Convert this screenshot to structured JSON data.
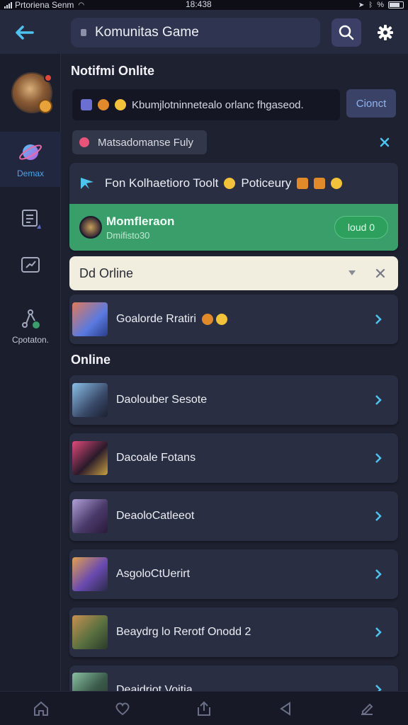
{
  "status_bar": {
    "carrier": "Prtoriena Senm",
    "time": "18:438",
    "battery": "%"
  },
  "header": {
    "title": "Komunitas Game"
  },
  "sidebar": {
    "items": [
      {
        "label": "Demax",
        "icon": "planet-icon",
        "active": true
      },
      {
        "label": "",
        "icon": "document-icon"
      },
      {
        "label": "",
        "icon": "chart-box-icon"
      },
      {
        "label": "Cpotaton.",
        "icon": "network-icon"
      }
    ]
  },
  "notifications": {
    "title": "Notifmi Onlite",
    "message": "Kbumjlotninnetealo orlanc fhgaseod.",
    "chat_button": "Cionct",
    "chip_label": "Matsadomanse Fuly"
  },
  "feature": {
    "text": "Fon Kolhaetioro Toolt",
    "text2": "Poticeury",
    "user_name": "Momfleraon",
    "user_sub": "Dmifisto30",
    "button": "loud 0"
  },
  "dropdown": {
    "label": "Dd Orline"
  },
  "top_item": {
    "label": "Goalorde Rratiri"
  },
  "online": {
    "title": "Online",
    "items": [
      {
        "label": "Daolouber Sesote"
      },
      {
        "label": "Dacoale Fotans"
      },
      {
        "label": "DeaoloCatleeot"
      },
      {
        "label": "AsgoloCtUerirt"
      },
      {
        "label": "Beaydrg lo Rerotf Onodd 2"
      },
      {
        "label": "Deaidriot Voitia"
      }
    ]
  },
  "colors": {
    "accent": "#4fc3ef",
    "online_green": "#3a9e6a",
    "background": "#1e2130"
  }
}
